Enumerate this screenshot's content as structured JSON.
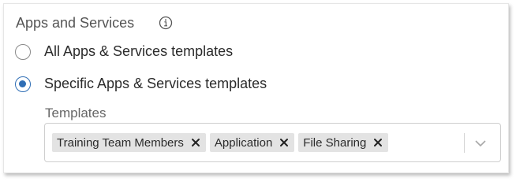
{
  "section": {
    "title": "Apps and Services",
    "info_icon": "info-circle-icon"
  },
  "options": [
    {
      "label": "All Apps & Services templates",
      "selected": false
    },
    {
      "label": "Specific Apps & Services templates",
      "selected": true
    }
  ],
  "templates": {
    "label": "Templates",
    "chips": [
      {
        "label": "Training Team Members",
        "remove_icon": "close-icon"
      },
      {
        "label": "Application",
        "remove_icon": "close-icon"
      },
      {
        "label": "File Sharing",
        "remove_icon": "close-icon"
      }
    ],
    "dropdown_icon": "chevron-down-icon"
  },
  "colors": {
    "accent": "#2f6eb5",
    "chip_bg": "#e3e3e3",
    "text": "#2b2b2b",
    "muted": "#555555"
  }
}
